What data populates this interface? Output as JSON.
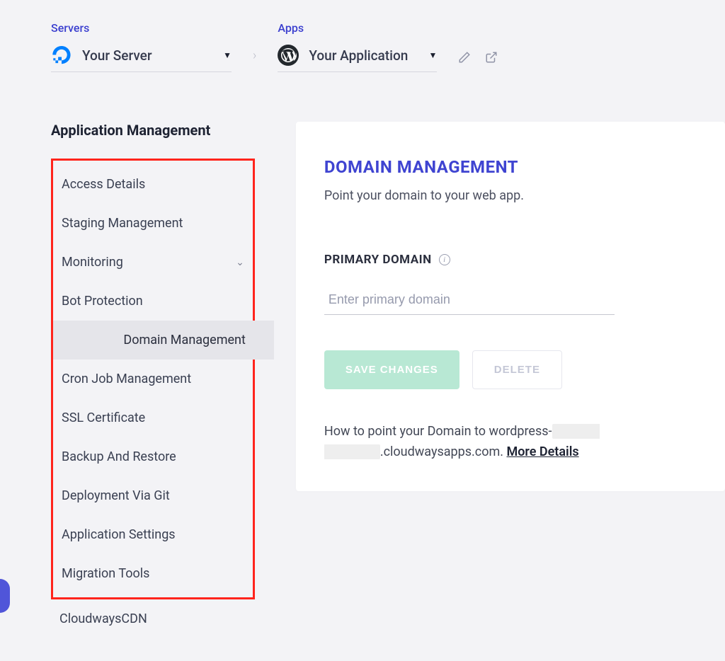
{
  "breadcrumb": {
    "servers_label": "Servers",
    "server_name": "Your Server",
    "apps_label": "Apps",
    "app_name": "Your Application"
  },
  "sidebar": {
    "title": "Application Management",
    "items": [
      {
        "label": "Access Details"
      },
      {
        "label": "Staging Management"
      },
      {
        "label": "Monitoring",
        "expandable": true
      },
      {
        "label": "Bot Protection"
      },
      {
        "label": "Domain Management",
        "active": true
      },
      {
        "label": "Cron Job Management"
      },
      {
        "label": "SSL Certificate"
      },
      {
        "label": "Backup And Restore"
      },
      {
        "label": "Deployment Via Git"
      },
      {
        "label": "Application Settings"
      },
      {
        "label": "Migration Tools"
      }
    ],
    "outside_item": {
      "label": "CloudwaysCDN"
    }
  },
  "panel": {
    "title": "DOMAIN MANAGEMENT",
    "subtitle": "Point your domain to your web app.",
    "primary_label": "PRIMARY DOMAIN",
    "input_placeholder": "Enter primary domain",
    "save_btn": "SAVE CHANGES",
    "delete_btn": "DELETE",
    "help_prefix": "How to point your Domain to wordpress-",
    "help_redacted": "XXXXXX XXXXXXX",
    "help_suffix": ".cloudwaysapps.com.   ",
    "more_details": "More Details"
  }
}
